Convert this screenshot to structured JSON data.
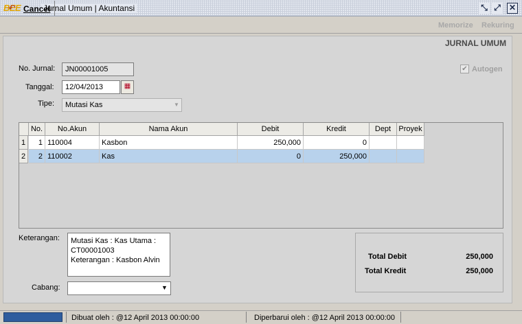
{
  "window": {
    "logo": "BEE",
    "title": "Jurnal Umum | Akuntansi",
    "min_icon": "↙↗",
    "close_icon": "✕"
  },
  "toolbar": {
    "cancel_label": "Cancel",
    "memorize_label": "Memorize",
    "rekuring_label": "Rekuring"
  },
  "form": {
    "title": "JURNAL UMUM",
    "no_jurnal_label": "No. Jurnal:",
    "no_jurnal_value": "JN00001005",
    "tanggal_label": "Tanggal:",
    "tanggal_value": "12/04/2013",
    "tipe_label": "Tipe:",
    "tipe_value": "Mutasi Kas",
    "autogen_label": "Autogen",
    "autogen_checked": true
  },
  "grid": {
    "columns": [
      "No.",
      "No.Akun",
      "Nama Akun",
      "Debit",
      "Kredit",
      "Dept",
      "Proyek"
    ],
    "rows": [
      {
        "row_number": "1",
        "no": "1",
        "no_akun": "110004",
        "nama_akun": "Kasbon",
        "debit": "250,000",
        "kredit": "0",
        "dept": "",
        "proyek": ""
      },
      {
        "row_number": "2",
        "no": "2",
        "no_akun": "110002",
        "nama_akun": "Kas",
        "debit": "0",
        "kredit": "250,000",
        "dept": "",
        "proyek": ""
      }
    ]
  },
  "keterangan": {
    "label": "Keterangan:",
    "line1": "Mutasi Kas : Kas Utama :",
    "line2": "CT00001003",
    "line3": "Keterangan : Kasbon Alvin"
  },
  "cabang": {
    "label": "Cabang:",
    "value": ""
  },
  "totals": {
    "debit_label": "Total Debit",
    "debit_value": "250,000",
    "kredit_label": "Total Kredit",
    "kredit_value": "250,000"
  },
  "status": {
    "created": "Dibuat oleh : @12 April 2013  00:00:00",
    "updated": "Diperbarui oleh : @12 April 2013  00:00:00"
  },
  "colors": {
    "selected_row": "#b8d2ec",
    "progress": "#2f5d9e"
  }
}
